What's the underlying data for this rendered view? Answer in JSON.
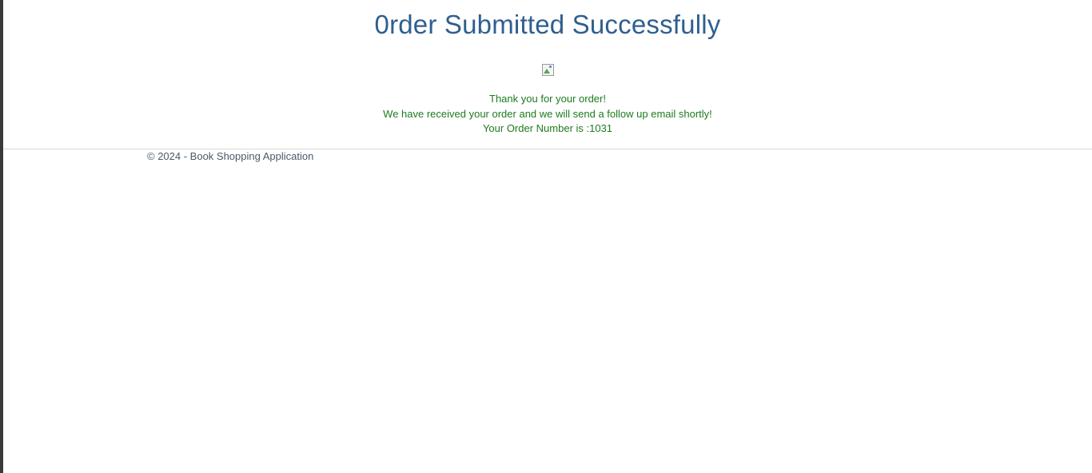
{
  "page": {
    "title": "0rder Submitted Successfully",
    "image_icon": "broken-image-icon",
    "messages": {
      "thank_you": "Thank you for your order!",
      "received": "We have received your order and we will send a follow up email shortly!",
      "order_number": "Your Order Number is :1031"
    }
  },
  "footer": {
    "copyright": "© 2024 - Book Shopping Application"
  },
  "colors": {
    "title": "#2f5f8f",
    "message": "#1e7b1e",
    "footer": "#4a5a6a",
    "divider": "#d8d8d8",
    "left_rail": "#3a3a3a"
  }
}
